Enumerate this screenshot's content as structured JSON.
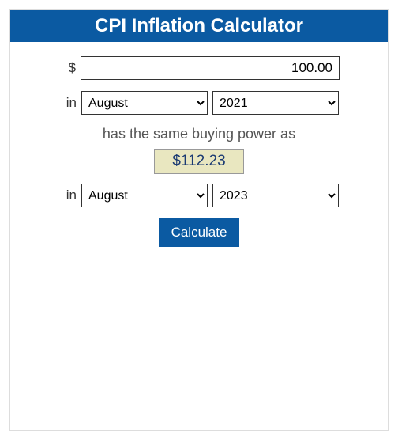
{
  "header": {
    "title": "CPI Inflation Calculator"
  },
  "amount": {
    "currency_symbol": "$",
    "value": "100.00"
  },
  "from": {
    "prefix": "in",
    "month": "August",
    "year": "2021"
  },
  "buying_power_text": "has the same buying power as",
  "result": {
    "display": "$112.23"
  },
  "to": {
    "prefix": "in",
    "month": "August",
    "year": "2023"
  },
  "calculate_label": "Calculate"
}
